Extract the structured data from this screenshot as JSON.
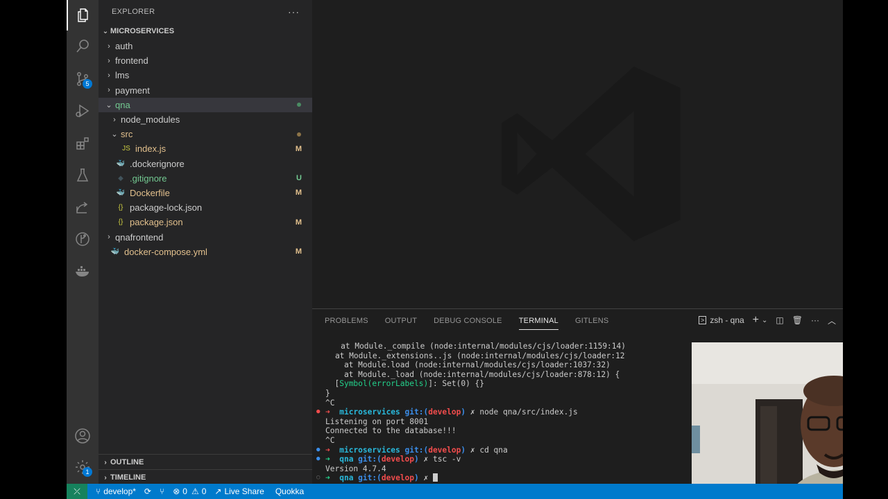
{
  "activity_bar": {
    "items": [
      {
        "name": "explorer-icon",
        "badge": ""
      },
      {
        "name": "search-icon",
        "badge": ""
      },
      {
        "name": "source-control-icon",
        "badge": "5"
      },
      {
        "name": "run-debug-icon",
        "badge": ""
      },
      {
        "name": "extensions-icon",
        "badge": ""
      },
      {
        "name": "testing-icon",
        "badge": ""
      },
      {
        "name": "live-share-icon",
        "badge": ""
      },
      {
        "name": "gitlens-icon",
        "badge": ""
      },
      {
        "name": "docker-icon",
        "badge": ""
      }
    ],
    "accounts_icon": "account-icon",
    "settings_badge": "1"
  },
  "sidebar": {
    "title": "EXPLORER",
    "more": "···",
    "root": "MICROSERVICES",
    "tree": [
      {
        "label": "auth",
        "depth": 1,
        "type": "folder",
        "open": false,
        "deco": "",
        "color": "#cccccc"
      },
      {
        "label": "frontend",
        "depth": 1,
        "type": "folder",
        "open": false,
        "deco": "",
        "color": "#cccccc"
      },
      {
        "label": "lms",
        "depth": 1,
        "type": "folder",
        "open": false,
        "deco": "",
        "color": "#cccccc"
      },
      {
        "label": "payment",
        "depth": 1,
        "type": "folder",
        "open": false,
        "deco": "",
        "color": "#cccccc"
      },
      {
        "label": "qna",
        "depth": 1,
        "type": "folder",
        "open": true,
        "deco": "dot-green",
        "color": "#73c991",
        "selected": true
      },
      {
        "label": "node_modules",
        "depth": 2,
        "type": "folder",
        "open": false,
        "deco": "",
        "color": "#cccccc"
      },
      {
        "label": "src",
        "depth": 2,
        "type": "folder",
        "open": true,
        "deco": "dot-yellow",
        "color": "#e2c08d"
      },
      {
        "label": "index.js",
        "depth": 3,
        "type": "js",
        "deco": "M",
        "color": "#e2c08d"
      },
      {
        "label": ".dockerignore",
        "depth": 2,
        "type": "docker-gray",
        "deco": "",
        "color": "#cccccc"
      },
      {
        "label": ".gitignore",
        "depth": 2,
        "type": "git",
        "deco": "U",
        "color": "#73c991"
      },
      {
        "label": "Dockerfile",
        "depth": 2,
        "type": "docker",
        "deco": "M",
        "color": "#e2c08d"
      },
      {
        "label": "package-lock.json",
        "depth": 2,
        "type": "json",
        "deco": "",
        "color": "#cccccc"
      },
      {
        "label": "package.json",
        "depth": 2,
        "type": "json",
        "deco": "M",
        "color": "#e2c08d"
      },
      {
        "label": "qnafrontend",
        "depth": 1,
        "type": "folder",
        "open": false,
        "deco": "",
        "color": "#cccccc"
      },
      {
        "label": "docker-compose.yml",
        "depth": 1,
        "type": "compose",
        "deco": "M",
        "color": "#e2c08d"
      }
    ],
    "outline": "OUTLINE",
    "timeline": "TIMELINE"
  },
  "panel": {
    "tabs": [
      "PROBLEMS",
      "OUTPUT",
      "DEBUG CONSOLE",
      "TERMINAL",
      "GITLENS"
    ],
    "active_tab": "TERMINAL",
    "terminal_name": "zsh - qna",
    "terminal_lines": [
      {
        "gut": "",
        "parts": [
          {
            "t": "    at Module._compile (node:internal/modules/cjs/loader:1159:14)",
            "c": ""
          }
        ]
      },
      {
        "gut": "",
        "parts": [
          {
            "t": "    at Module._extensions..js (node:internal/modules/cjs/loader:1213:10)",
            "c": ""
          }
        ]
      },
      {
        "gut": "",
        "parts": [
          {
            "t": "    at Module.load (node:internal/modules/cjs/loader:1037:32)",
            "c": ""
          }
        ]
      },
      {
        "gut": "",
        "parts": [
          {
            "t": "    at Module._load (node:internal/modules/cjs/loader:878:12) {",
            "c": ""
          }
        ]
      },
      {
        "gut": "",
        "parts": [
          {
            "t": "  [",
            "c": ""
          },
          {
            "t": "Symbol(errorLabels)",
            "c": "green"
          },
          {
            "t": "]: Set(0) {}",
            "c": ""
          }
        ]
      },
      {
        "gut": "",
        "parts": [
          {
            "t": "}",
            "c": ""
          }
        ]
      },
      {
        "gut": "",
        "parts": [
          {
            "t": "^C",
            "c": ""
          }
        ]
      },
      {
        "gut": "red",
        "parts": [
          {
            "t": "➜  ",
            "c": "red"
          },
          {
            "t": "microservices ",
            "c": "cyan bold"
          },
          {
            "t": "git:(",
            "c": "blue bold"
          },
          {
            "t": "develop",
            "c": "red bold"
          },
          {
            "t": ") ",
            "c": "blue bold"
          },
          {
            "t": "✗ ",
            "c": ""
          },
          {
            "t": "node qna/src/index.js",
            "c": ""
          }
        ]
      },
      {
        "gut": "",
        "parts": [
          {
            "t": "Listening on port 8001",
            "c": ""
          }
        ]
      },
      {
        "gut": "",
        "parts": [
          {
            "t": "Connected to the database!!!",
            "c": ""
          }
        ]
      },
      {
        "gut": "",
        "parts": [
          {
            "t": "^C",
            "c": ""
          }
        ]
      },
      {
        "gut": "blue",
        "parts": [
          {
            "t": "➜  ",
            "c": "red"
          },
          {
            "t": "microservices ",
            "c": "cyan bold"
          },
          {
            "t": "git:(",
            "c": "blue bold"
          },
          {
            "t": "develop",
            "c": "red bold"
          },
          {
            "t": ") ",
            "c": "blue bold"
          },
          {
            "t": "✗ ",
            "c": ""
          },
          {
            "t": "cd qna",
            "c": ""
          }
        ]
      },
      {
        "gut": "blue",
        "parts": [
          {
            "t": "➜  ",
            "c": "green"
          },
          {
            "t": "qna ",
            "c": "cyan bold"
          },
          {
            "t": "git:(",
            "c": "blue bold"
          },
          {
            "t": "develop",
            "c": "red bold"
          },
          {
            "t": ") ",
            "c": "blue bold"
          },
          {
            "t": "✗ ",
            "c": ""
          },
          {
            "t": "tsc -v",
            "c": ""
          }
        ]
      },
      {
        "gut": "",
        "parts": [
          {
            "t": "Version 4.7.4",
            "c": ""
          }
        ]
      },
      {
        "gut": "gray",
        "parts": [
          {
            "t": "➜  ",
            "c": "green"
          },
          {
            "t": "qna ",
            "c": "cyan bold"
          },
          {
            "t": "git:(",
            "c": "blue bold"
          },
          {
            "t": "develop",
            "c": "red bold"
          },
          {
            "t": ") ",
            "c": "blue bold"
          },
          {
            "t": "✗ ",
            "c": ""
          }
        ],
        "cursor": true
      }
    ]
  },
  "status_bar": {
    "branch": "develop*",
    "errors": "0",
    "warnings": "0",
    "live_share": "Live Share",
    "quokka": "Quokka"
  },
  "colors": {
    "accent": "#007acc",
    "remote": "#16825d",
    "modified": "#e2c08d",
    "untracked": "#73c991"
  }
}
